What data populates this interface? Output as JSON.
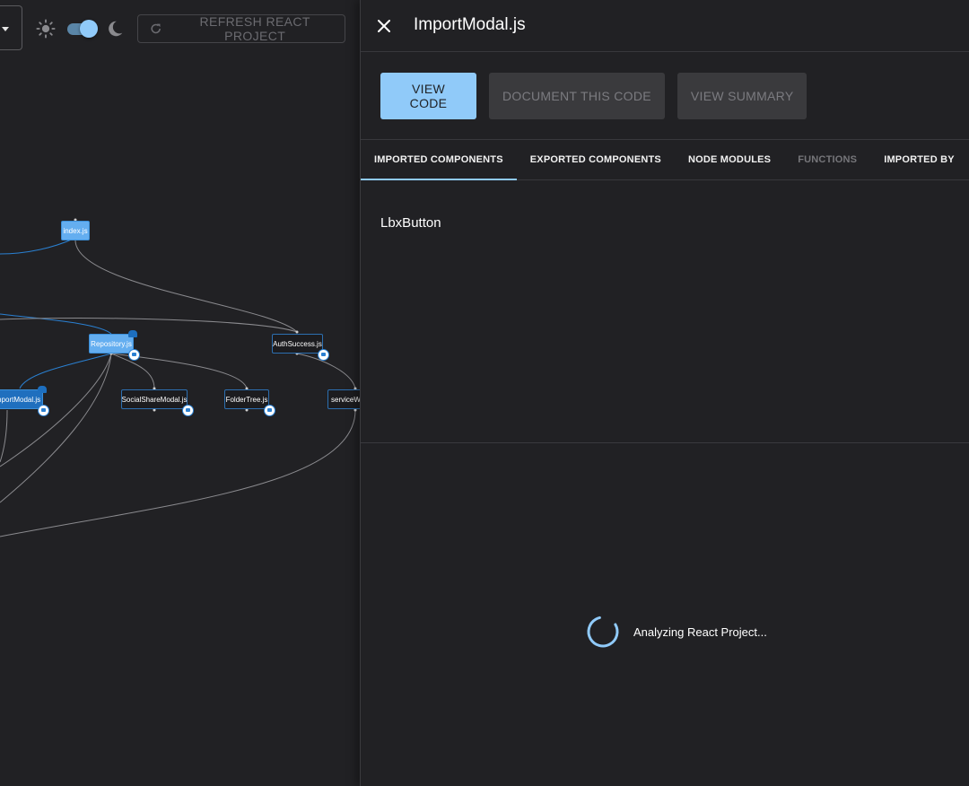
{
  "toolbar": {
    "refresh_label": "REFRESH REACT PROJECT",
    "theme_toggle_on": true,
    "icons": [
      "chevron-down-icon",
      "sun-icon",
      "moon-icon",
      "refresh-icon"
    ]
  },
  "graph": {
    "nodes": [
      {
        "label": "index.js",
        "style": "filled"
      },
      {
        "label": "Repository.js",
        "style": "filled"
      },
      {
        "label": "AuthSuccess.js",
        "style": "outline"
      },
      {
        "label": "ImportModal.js",
        "style": "selected"
      },
      {
        "label": "SocialShareModal.js",
        "style": "outline"
      },
      {
        "label": "FolderTree.js",
        "style": "outline"
      },
      {
        "label": "serviceWo",
        "style": "outline"
      }
    ],
    "node_display": [
      "index.js",
      "Repository.js",
      "AuthSuccess.js",
      "mportModal.js",
      "SocialShareModal.js",
      "FolderTree.js",
      "serviceW"
    ]
  },
  "drawer": {
    "title": "ImportModal.js",
    "actions": {
      "view_code": "VIEW CODE",
      "document_code": "DOCUMENT THIS CODE",
      "view_summary": "VIEW SUMMARY"
    },
    "tabs": [
      {
        "label": "IMPORTED COMPONENTS",
        "state": "active"
      },
      {
        "label": "EXPORTED COMPONENTS",
        "state": "normal"
      },
      {
        "label": "NODE MODULES",
        "state": "normal"
      },
      {
        "label": "FUNCTIONS",
        "state": "disabled"
      },
      {
        "label": "IMPORTED BY",
        "state": "normal"
      }
    ],
    "imported_components": [
      "LbxButton"
    ],
    "loading_text": "Analyzing React Project..."
  },
  "colors": {
    "background": "#212124",
    "accent": "#90caf9",
    "node_fill": "#64aef0",
    "node_selected": "#1f6fbe",
    "edge_default": "#8a8a8e",
    "edge_highlight": "#2a80d2"
  }
}
